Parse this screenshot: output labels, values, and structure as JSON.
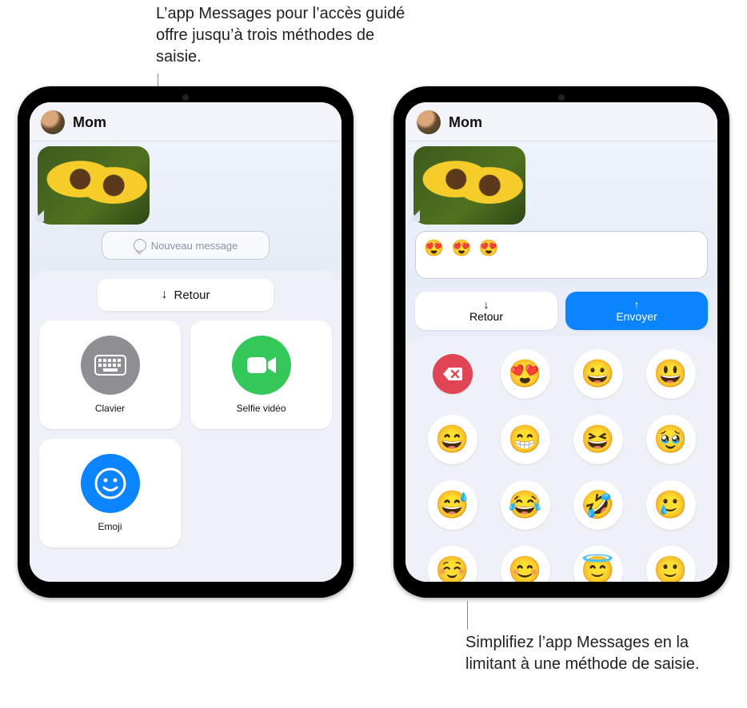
{
  "callouts": {
    "top": "L’app Messages pour l’accès guidé offre jusqu’à trois méthodes de saisie.",
    "bottom": "Simplifiez l’app Messages en la limitant à une méthode de saisie."
  },
  "left_ipad": {
    "contact_name": "Mom",
    "compose_placeholder": "Nouveau message",
    "back_label": "Retour",
    "methods": [
      {
        "id": "keyboard",
        "label": "Clavier",
        "icon": "keyboard-icon",
        "color": "gray"
      },
      {
        "id": "video",
        "label": "Selfie vidéo",
        "icon": "video-icon",
        "color": "green"
      },
      {
        "id": "emoji",
        "label": "Emoji",
        "icon": "emoji-icon",
        "color": "blue"
      }
    ]
  },
  "right_ipad": {
    "contact_name": "Mom",
    "compose_value": "😍 😍 😍",
    "back_label": "Retour",
    "send_label": "Envoyer",
    "emoji_keys": [
      "__DELETE__",
      "😍",
      "😀",
      "😃",
      "😄",
      "😁",
      "😆",
      "🥹",
      "😅",
      "😂",
      "🤣",
      "🥲",
      "☺️",
      "😊",
      "😇",
      "🙂"
    ]
  }
}
